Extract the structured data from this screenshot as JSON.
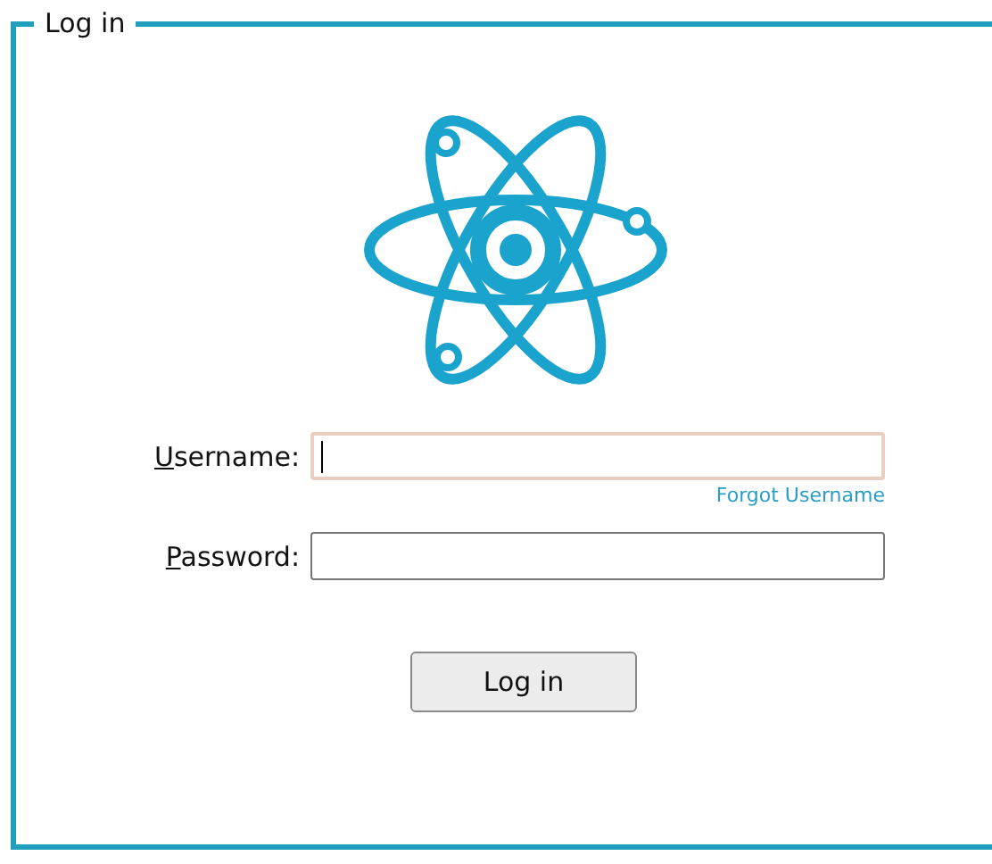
{
  "panel": {
    "title": "Log in"
  },
  "fields": [
    {
      "label": "Username:",
      "underline_first": true,
      "kind": "text",
      "focused": true,
      "link": "Forgot Username"
    },
    {
      "label": "Password:",
      "underline_first": true,
      "kind": "password",
      "focused": false
    }
  ],
  "buttons": [
    "Log in"
  ]
}
